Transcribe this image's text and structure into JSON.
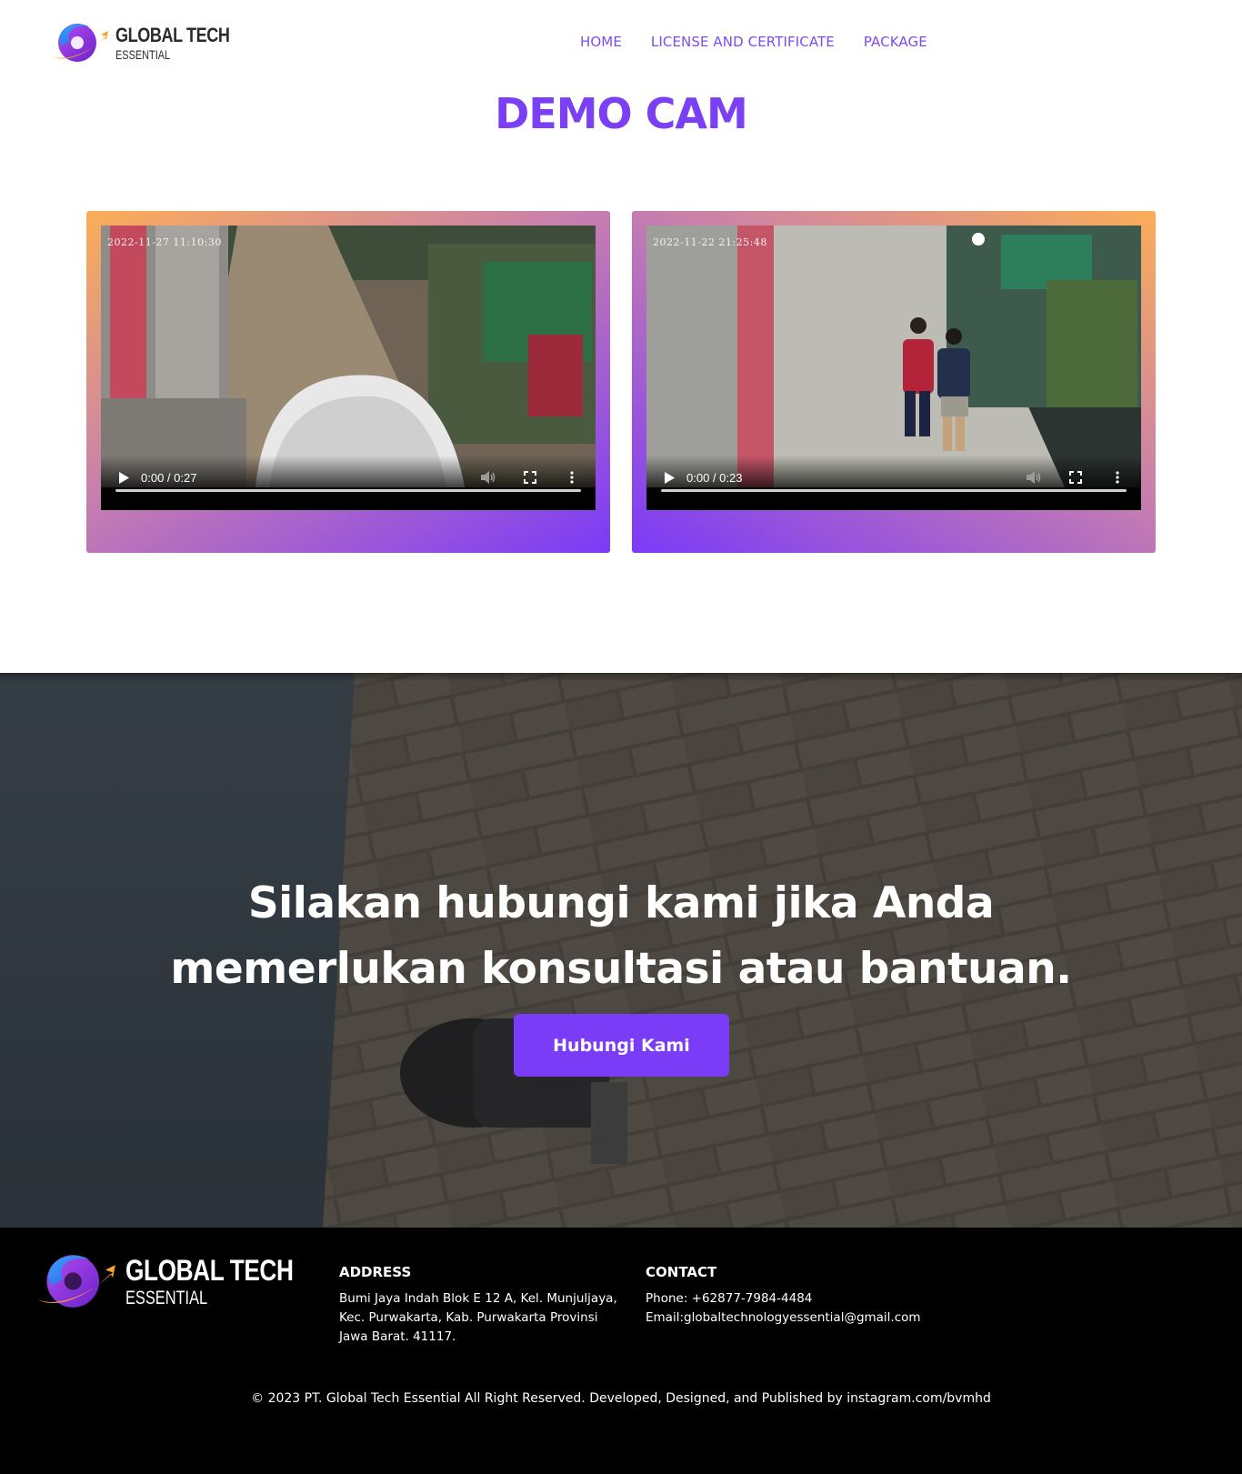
{
  "brand": {
    "title": "GLOBAL TECH",
    "subtitle": "ESSENTIAL",
    "colors": {
      "accent": "#7b3ff6",
      "gradient_orange": "#fbae57",
      "footer_bg": "#000000"
    }
  },
  "nav": {
    "items": [
      {
        "label": "HOME"
      },
      {
        "label": "LICENSE AND CERTIFICATE"
      },
      {
        "label": "PACKAGE"
      }
    ]
  },
  "page": {
    "title": "DEMO CAM"
  },
  "videos": [
    {
      "timestamp": "2022-11-27  11:10:30",
      "time": "0:00 / 0:27",
      "progress": 0
    },
    {
      "timestamp": "2022-11-22  21:25:48",
      "time": "0:00 / 0:23",
      "progress": 0
    }
  ],
  "cta": {
    "line1": "Silakan hubungi kami jika Anda",
    "line2": "memerlukan konsultasi atau bantuan.",
    "button": "Hubungi Kami"
  },
  "footer": {
    "address": {
      "heading": "ADDRESS",
      "lines": [
        "Bumi Jaya Indah Blok E 12 A, Kel. Munjuljaya,",
        "Kec. Purwakarta, Kab. Purwakarta Provinsi",
        "Jawa Barat. 41117."
      ]
    },
    "contact": {
      "heading": "CONTACT",
      "phone": "Phone: +62877-7984-4484",
      "email": "Email:globaltechnologyessential@gmail.com"
    },
    "copyright": "© 2023 PT. Global Tech Essential All Right Reserved. Developed, Designed, and Published by instagram.com/bvmhd"
  }
}
